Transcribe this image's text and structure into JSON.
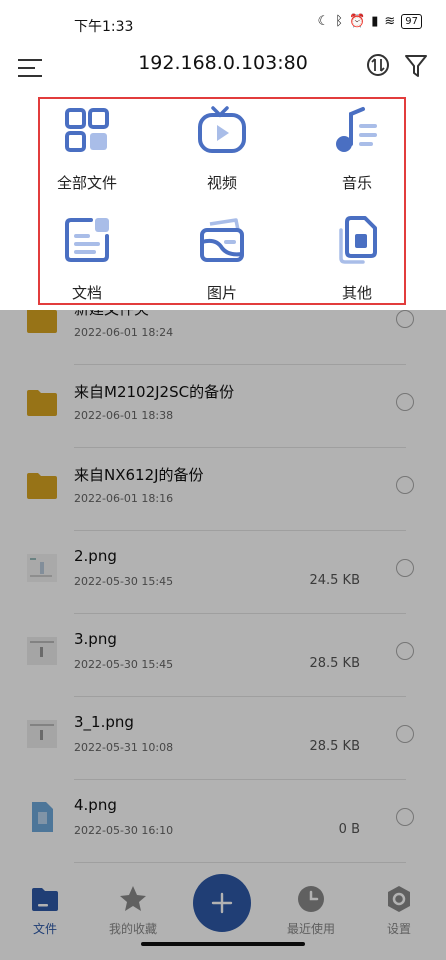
{
  "status_bar": {
    "time": "下午1:33",
    "battery": "97",
    "icons": [
      "moon-icon",
      "bluetooth-icon",
      "alarm-icon",
      "signal-icon",
      "wifi-icon",
      "battery-icon"
    ]
  },
  "header": {
    "title": "192.168.0.103:80",
    "icons": [
      "menu-icon",
      "sort-icon",
      "filter-icon"
    ]
  },
  "categories": [
    {
      "label": "全部文件",
      "icon": "grid-icon"
    },
    {
      "label": "视频",
      "icon": "video-icon"
    },
    {
      "label": "音乐",
      "icon": "music-icon"
    },
    {
      "label": "文档",
      "icon": "document-icon"
    },
    {
      "label": "图片",
      "icon": "image-icon"
    },
    {
      "label": "其他",
      "icon": "other-files-icon"
    }
  ],
  "files": [
    {
      "name": "新建文件夹",
      "date": "2022-06-01 18:24",
      "size": "",
      "type": "folder"
    },
    {
      "name": "来自M2102J2SC的备份",
      "date": "2022-06-01 18:38",
      "size": "",
      "type": "folder"
    },
    {
      "name": "来自NX612J的备份",
      "date": "2022-06-01 18:16",
      "size": "",
      "type": "folder"
    },
    {
      "name": "2.png",
      "date": "2022-05-30 15:45",
      "size": "24.5 KB",
      "type": "image"
    },
    {
      "name": "3.png",
      "date": "2022-05-30 15:45",
      "size": "28.5 KB",
      "type": "image"
    },
    {
      "name": "3_1.png",
      "date": "2022-05-31 10:08",
      "size": "28.5 KB",
      "type": "image"
    },
    {
      "name": "4.png",
      "date": "2022-05-30 16:10",
      "size": "0 B",
      "type": "image-blank"
    }
  ],
  "bottom_nav": [
    {
      "label": "文件",
      "icon": "folder-icon",
      "active": true
    },
    {
      "label": "我的收藏",
      "icon": "star-icon",
      "active": false
    },
    {
      "label": "",
      "icon": "plus-icon",
      "active": false
    },
    {
      "label": "最近使用",
      "icon": "clock-icon",
      "active": false
    },
    {
      "label": "设置",
      "icon": "settings-icon",
      "active": false
    }
  ],
  "colors": {
    "accent": "#2e5aa8",
    "icon_blue": "#4a6fc2",
    "icon_light": "#a9bde8",
    "folder": "#d9a521",
    "highlight": "#e23c3c"
  }
}
